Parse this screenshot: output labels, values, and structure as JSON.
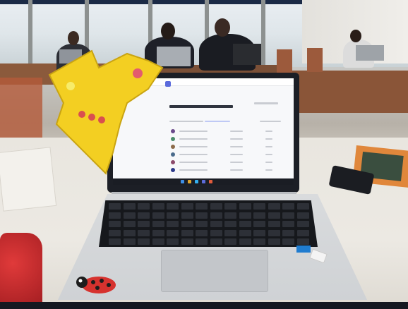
{
  "scene": {
    "subject": "laptop",
    "colors": {
      "crown": "#f3cf22",
      "ladybug": "#d6322e",
      "desk": "#8b5a3c",
      "screen_bg": "#f7f8fa"
    }
  },
  "screen_ui": {
    "window_title": "",
    "page_title": ""
  }
}
